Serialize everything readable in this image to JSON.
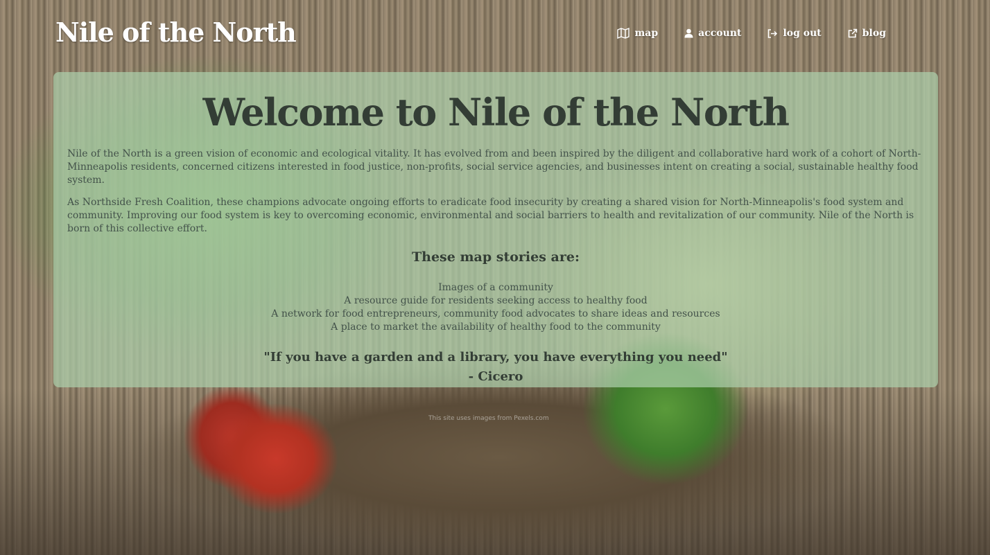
{
  "header": {
    "brand": "Nile of the North",
    "nav": [
      {
        "label": "map",
        "icon": "map-icon"
      },
      {
        "label": "account",
        "icon": "user-icon"
      },
      {
        "label": "log out",
        "icon": "sign-out-icon"
      },
      {
        "label": "blog",
        "icon": "external-link-icon"
      }
    ]
  },
  "panel": {
    "title": "Welcome to Nile of the North",
    "paragraphs": [
      "Nile of the North is a green vision of economic and ecological vitality. It has evolved from and been inspired by the diligent and collaborative hard work of a cohort of North-Minneapolis residents, concerned citizens interested in food justice, non-profits, social service agencies, and businesses intent on creating a social, sustainable healthy food system.",
      "As Northside Fresh Coalition, these champions advocate ongoing efforts to eradicate food insecurity by creating a shared vision for North-Minneapolis's food system and community. Improving our food system is key to overcoming economic, environmental and social barriers to health and revitalization of our community. Nile of the North is born of this collective effort."
    ],
    "stories_heading": "These map stories are:",
    "stories": [
      "Images of a community",
      "A resource guide for residents seeking access to healthy food",
      "A network for food entrepreneurs, community food advocates to share ideas and resources",
      "A place to market the availability of healthy food to the community"
    ],
    "quote": "\"If you have a garden and a library, you have everything you need\"",
    "quote_author": "- Cicero"
  },
  "footer": {
    "note": "This site uses images from Pexels.com"
  },
  "colors": {
    "panel_bg": "#accfaa",
    "heading_text": "#333d35",
    "body_text": "#43524a",
    "nav_text": "#ffffff"
  }
}
